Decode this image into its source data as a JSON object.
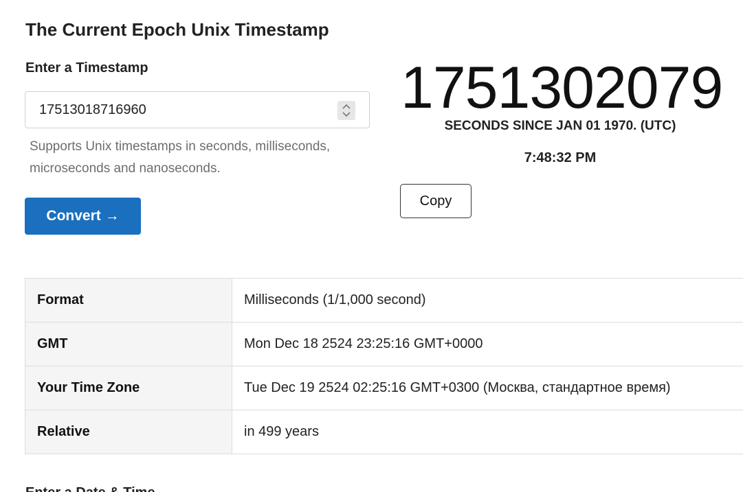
{
  "page": {
    "title": "The Current Epoch Unix Timestamp"
  },
  "converter": {
    "label": "Enter a Timestamp",
    "input_value": "17513018716960",
    "help": "Supports Unix timestamps in seconds, milliseconds, microseconds and nanoseconds.",
    "convert_label": "Convert →"
  },
  "current": {
    "timestamp": "1751302079",
    "caption": "SECONDS SINCE JAN 01 1970. (UTC)",
    "time": "7:48:32 PM",
    "copy_label": "Copy"
  },
  "results": [
    {
      "key": "Format",
      "value": "Milliseconds (1/1,000 second)"
    },
    {
      "key": "GMT",
      "value": "Mon Dec 18 2524 23:25:16 GMT+0000"
    },
    {
      "key": "Your Time Zone",
      "value": "Tue Dec 19 2524 02:25:16 GMT+0300 (Москва, стандартное время)"
    },
    {
      "key": "Relative",
      "value": "in 499 years"
    }
  ],
  "next_section": {
    "title": "Enter a Date & Time"
  },
  "colors": {
    "primary_button": "#1a6fbe",
    "table_key_bg": "#f5f5f5",
    "border": "#dcdcdc"
  },
  "icons": {
    "spinner": "up-down-chevron-icon",
    "convert_arrow": "right-arrow"
  }
}
